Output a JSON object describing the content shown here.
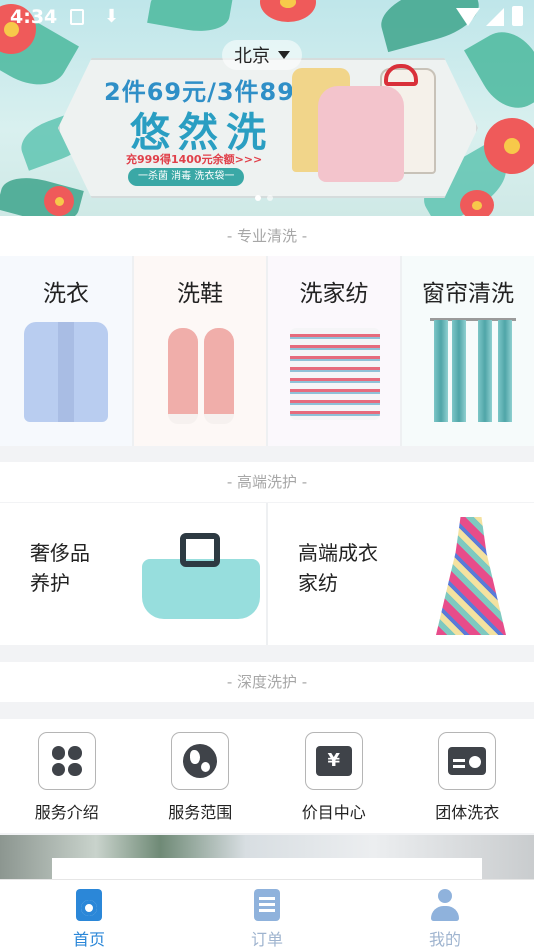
{
  "status_bar": {
    "time": "4:34"
  },
  "banner": {
    "city": "北京",
    "promo_line1": "2件69元/3件89元",
    "promo_title": "悠然洗",
    "promo_line3": "充999得1400元余额>>>",
    "promo_tag": "一杀菌 消毒 洗衣袋一"
  },
  "pro_wash": {
    "section_label": "- 专业清洗 -",
    "items": [
      {
        "label": "洗衣",
        "icon": "shirt-image"
      },
      {
        "label": "洗鞋",
        "icon": "shoes-image"
      },
      {
        "label": "洗家纺",
        "icon": "bedding-image"
      },
      {
        "label": "窗帘清洗",
        "icon": "curtain-image"
      }
    ]
  },
  "premium_care": {
    "section_label": "- 高端洗护 -",
    "items": [
      {
        "line1": "奢侈品",
        "line2": "养护",
        "icon": "handbag-image"
      },
      {
        "line1": "高端成衣",
        "line2": "家纺",
        "icon": "dress-image"
      }
    ]
  },
  "deep_care": {
    "section_label": "- 深度洗护 -",
    "items": [
      {
        "label": "服务介绍",
        "icon": "clover-icon"
      },
      {
        "label": "服务范围",
        "icon": "globe-icon"
      },
      {
        "label": "价目中心",
        "icon": "price-icon",
        "glyph": "¥"
      },
      {
        "label": "团体洗衣",
        "icon": "id-card-icon"
      }
    ]
  },
  "tabbar": {
    "tabs": [
      {
        "label": "首页",
        "icon": "washer-icon",
        "active": true
      },
      {
        "label": "订单",
        "icon": "order-list-icon",
        "active": false
      },
      {
        "label": "我的",
        "icon": "user-icon",
        "active": false
      }
    ]
  },
  "colors": {
    "accent": "#2b87d8",
    "inactive_tab": "#9fb4cf",
    "section_label": "#a7a7a7"
  }
}
